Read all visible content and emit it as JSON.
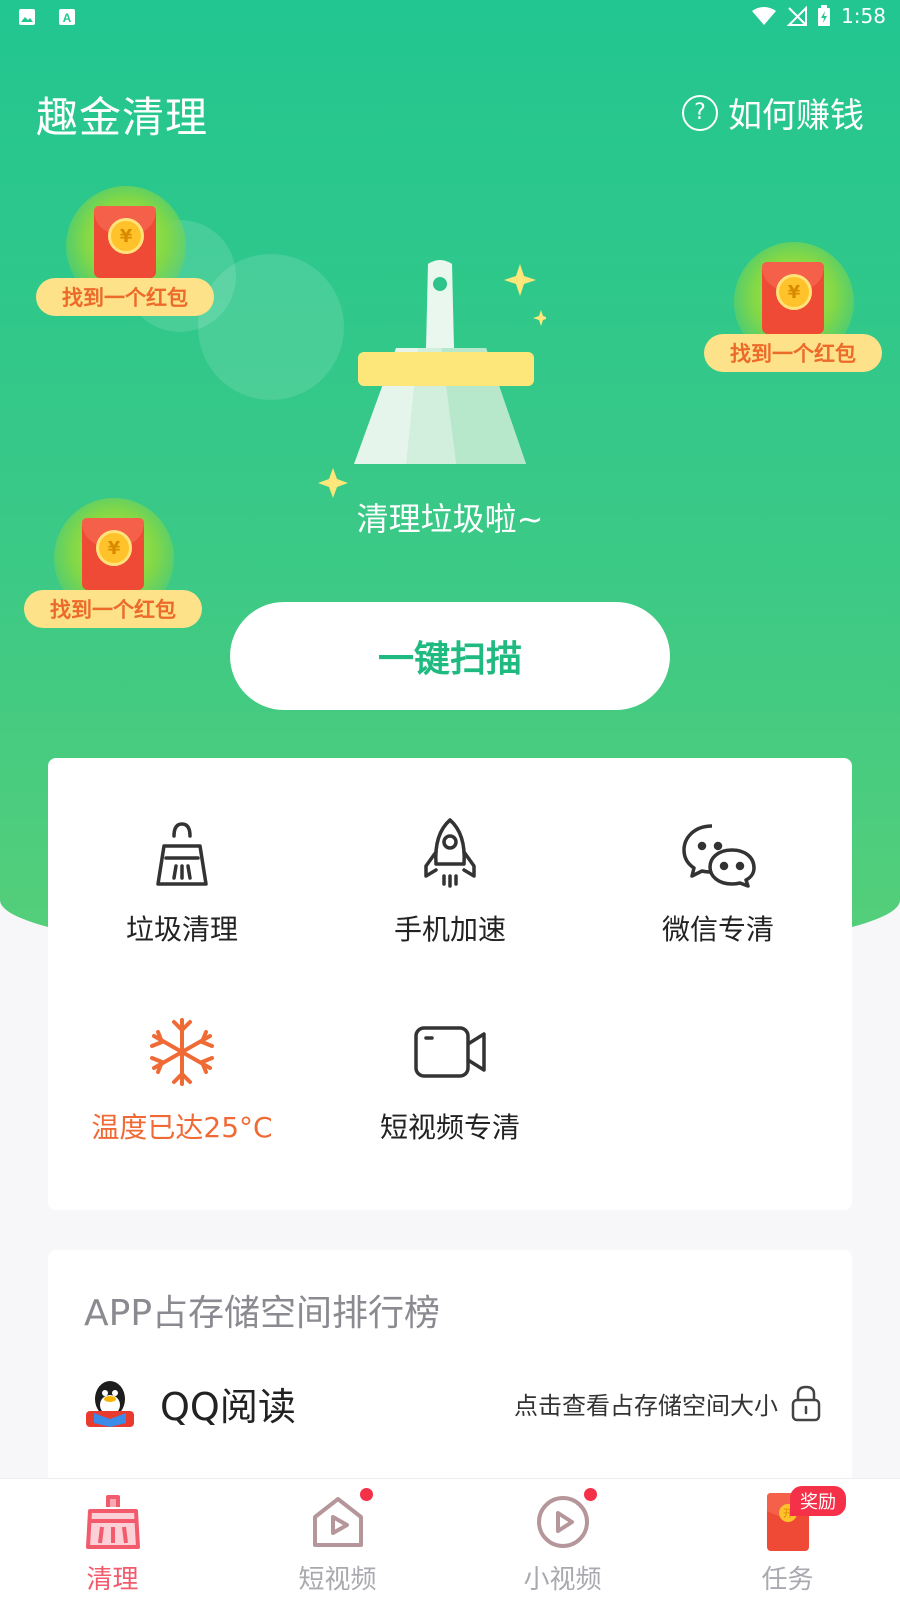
{
  "status_bar": {
    "time": "1:58"
  },
  "header": {
    "title": "趣金清理",
    "earn_label": "如何赚钱"
  },
  "red_packets": [
    {
      "tag": "找到一个红包"
    },
    {
      "tag": "找到一个红包"
    },
    {
      "tag": "找到一个红包"
    }
  ],
  "hero": {
    "caption": "清理垃圾啦~",
    "scan_button": "一键扫描"
  },
  "tools": [
    {
      "label": "垃圾清理",
      "icon": "broom-icon"
    },
    {
      "label": "手机加速",
      "icon": "rocket-icon"
    },
    {
      "label": "微信专清",
      "icon": "wechat-icon"
    },
    {
      "label": "温度已达25°C",
      "icon": "snowflake-icon"
    },
    {
      "label": "短视频专清",
      "icon": "video-camera-icon"
    }
  ],
  "ranking": {
    "title": "APP占存储空间排行榜",
    "items": [
      {
        "app": "QQ阅读",
        "hint": "点击查看占存储空间大小"
      }
    ]
  },
  "tabs": [
    {
      "label": "清理",
      "active": true
    },
    {
      "label": "短视频"
    },
    {
      "label": "小视频"
    },
    {
      "label": "任务",
      "badge": "奖励"
    }
  ],
  "colors": {
    "primary_green": "#22c690",
    "accent_red": "#f15b6c",
    "warning_orange": "#f06a36"
  }
}
